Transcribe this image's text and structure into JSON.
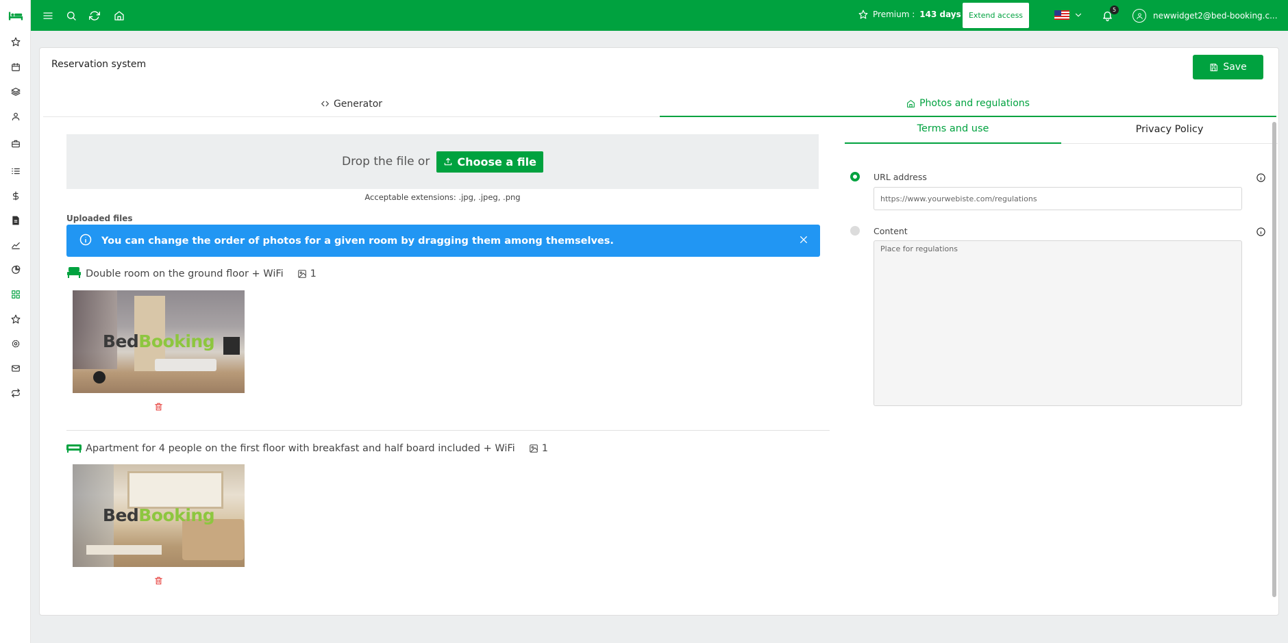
{
  "topbar": {
    "premium_label": "Premium :",
    "premium_days": "143 days",
    "extend_label": "Extend access",
    "notification_count": "5",
    "user_email": "newwidget2@bed-booking.c..."
  },
  "page": {
    "title": "Reservation system",
    "save_label": "Save"
  },
  "tabs": {
    "generator": "Generator",
    "photos": "Photos and regulations"
  },
  "upload": {
    "drop_text": "Drop the file or",
    "choose_label": "Choose a file",
    "extensions": "Acceptable extensions: .jpg, .jpeg, .png",
    "uploaded_label": "Uploaded files",
    "info_message": "You can change the order of photos for a given room by dragging them among themselves."
  },
  "rooms": [
    {
      "name": "Double room on the ground floor + WiFi",
      "photo_count": "1",
      "watermark_a": "Bed",
      "watermark_b": "Booking"
    },
    {
      "name": "Apartment for 4 people on the first floor with breakfast and half board included + WiFi",
      "photo_count": "1",
      "watermark_a": "Bed",
      "watermark_b": "Booking"
    }
  ],
  "regulations": {
    "tab_terms": "Terms and use",
    "tab_privacy": "Privacy Policy",
    "url_label": "URL address",
    "url_placeholder": "https://www.yourwebiste.com/regulations",
    "content_label": "Content",
    "content_placeholder": "Place for regulations"
  },
  "colors": {
    "brand_green": "#00a23f",
    "info_blue": "#2196f3",
    "delete_red": "#e53935"
  }
}
